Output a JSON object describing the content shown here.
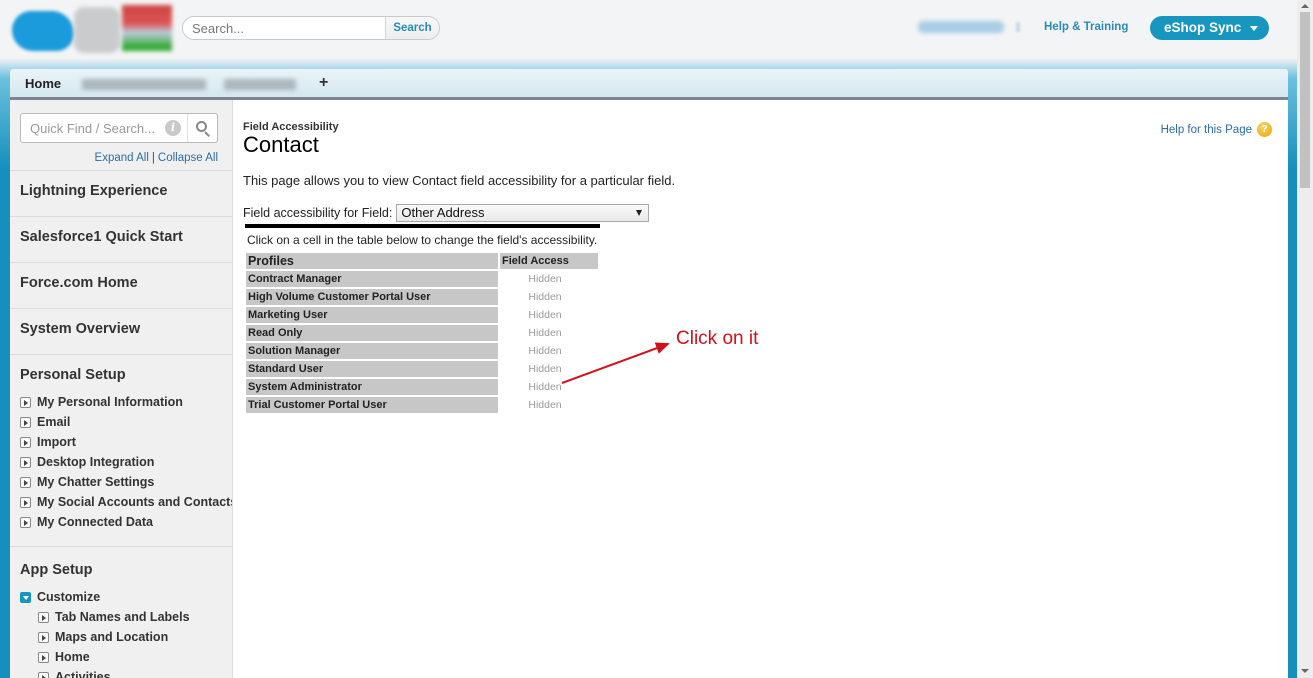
{
  "header": {
    "search_placeholder": "Search...",
    "search_button": "Search",
    "help_training": "Help & Training",
    "app_switcher": "eShop Sync"
  },
  "tabs": [
    {
      "label": "Home"
    },
    {
      "label": "+"
    }
  ],
  "sidebar": {
    "quick_find_placeholder": "Quick Find / Search...",
    "expand_all": "Expand All",
    "separator": "|",
    "collapse_all": "Collapse All",
    "sections": [
      {
        "title": "Lightning Experience"
      },
      {
        "title": "Salesforce1 Quick Start"
      },
      {
        "title": "Force.com Home"
      },
      {
        "title": "System Overview"
      },
      {
        "title": "Personal Setup"
      },
      {
        "title": "App Setup"
      }
    ],
    "personal_setup_items": [
      "My Personal Information",
      "Email",
      "Import",
      "Desktop Integration",
      "My Chatter Settings",
      "My Social Accounts and Contacts",
      "My Connected Data"
    ],
    "app_setup": {
      "customize": "Customize",
      "customize_items": [
        "Tab Names and Labels",
        "Maps and Location",
        "Home",
        "Activities"
      ]
    }
  },
  "main": {
    "breadcrumb": "Field Accessibility",
    "title": "Contact",
    "help_link": "Help for this Page",
    "help_icon": "?",
    "description": "This page allows you to view Contact field accessibility for a particular field.",
    "field_label": "Field accessibility for Field:",
    "field_selected": "Other Address",
    "instruction": "Click on a cell in the table below to change the field's accessibility.",
    "table": {
      "headers": [
        "Profiles",
        "Field Access"
      ],
      "rows": [
        {
          "profile": "Contract Manager",
          "access": "Hidden"
        },
        {
          "profile": "High Volume Customer Portal User",
          "access": "Hidden"
        },
        {
          "profile": "Marketing User",
          "access": "Hidden"
        },
        {
          "profile": "Read Only",
          "access": "Hidden"
        },
        {
          "profile": "Solution Manager",
          "access": "Hidden"
        },
        {
          "profile": "Standard User",
          "access": "Hidden"
        },
        {
          "profile": "System Administrator",
          "access": "Hidden"
        },
        {
          "profile": "Trial Customer Portal User",
          "access": "Hidden"
        }
      ]
    },
    "annotation": "Click on it",
    "annotation_color": "#d0101b"
  },
  "colors": {
    "brand_blue": "#1797c0",
    "link_blue": "#2a6ea6"
  }
}
